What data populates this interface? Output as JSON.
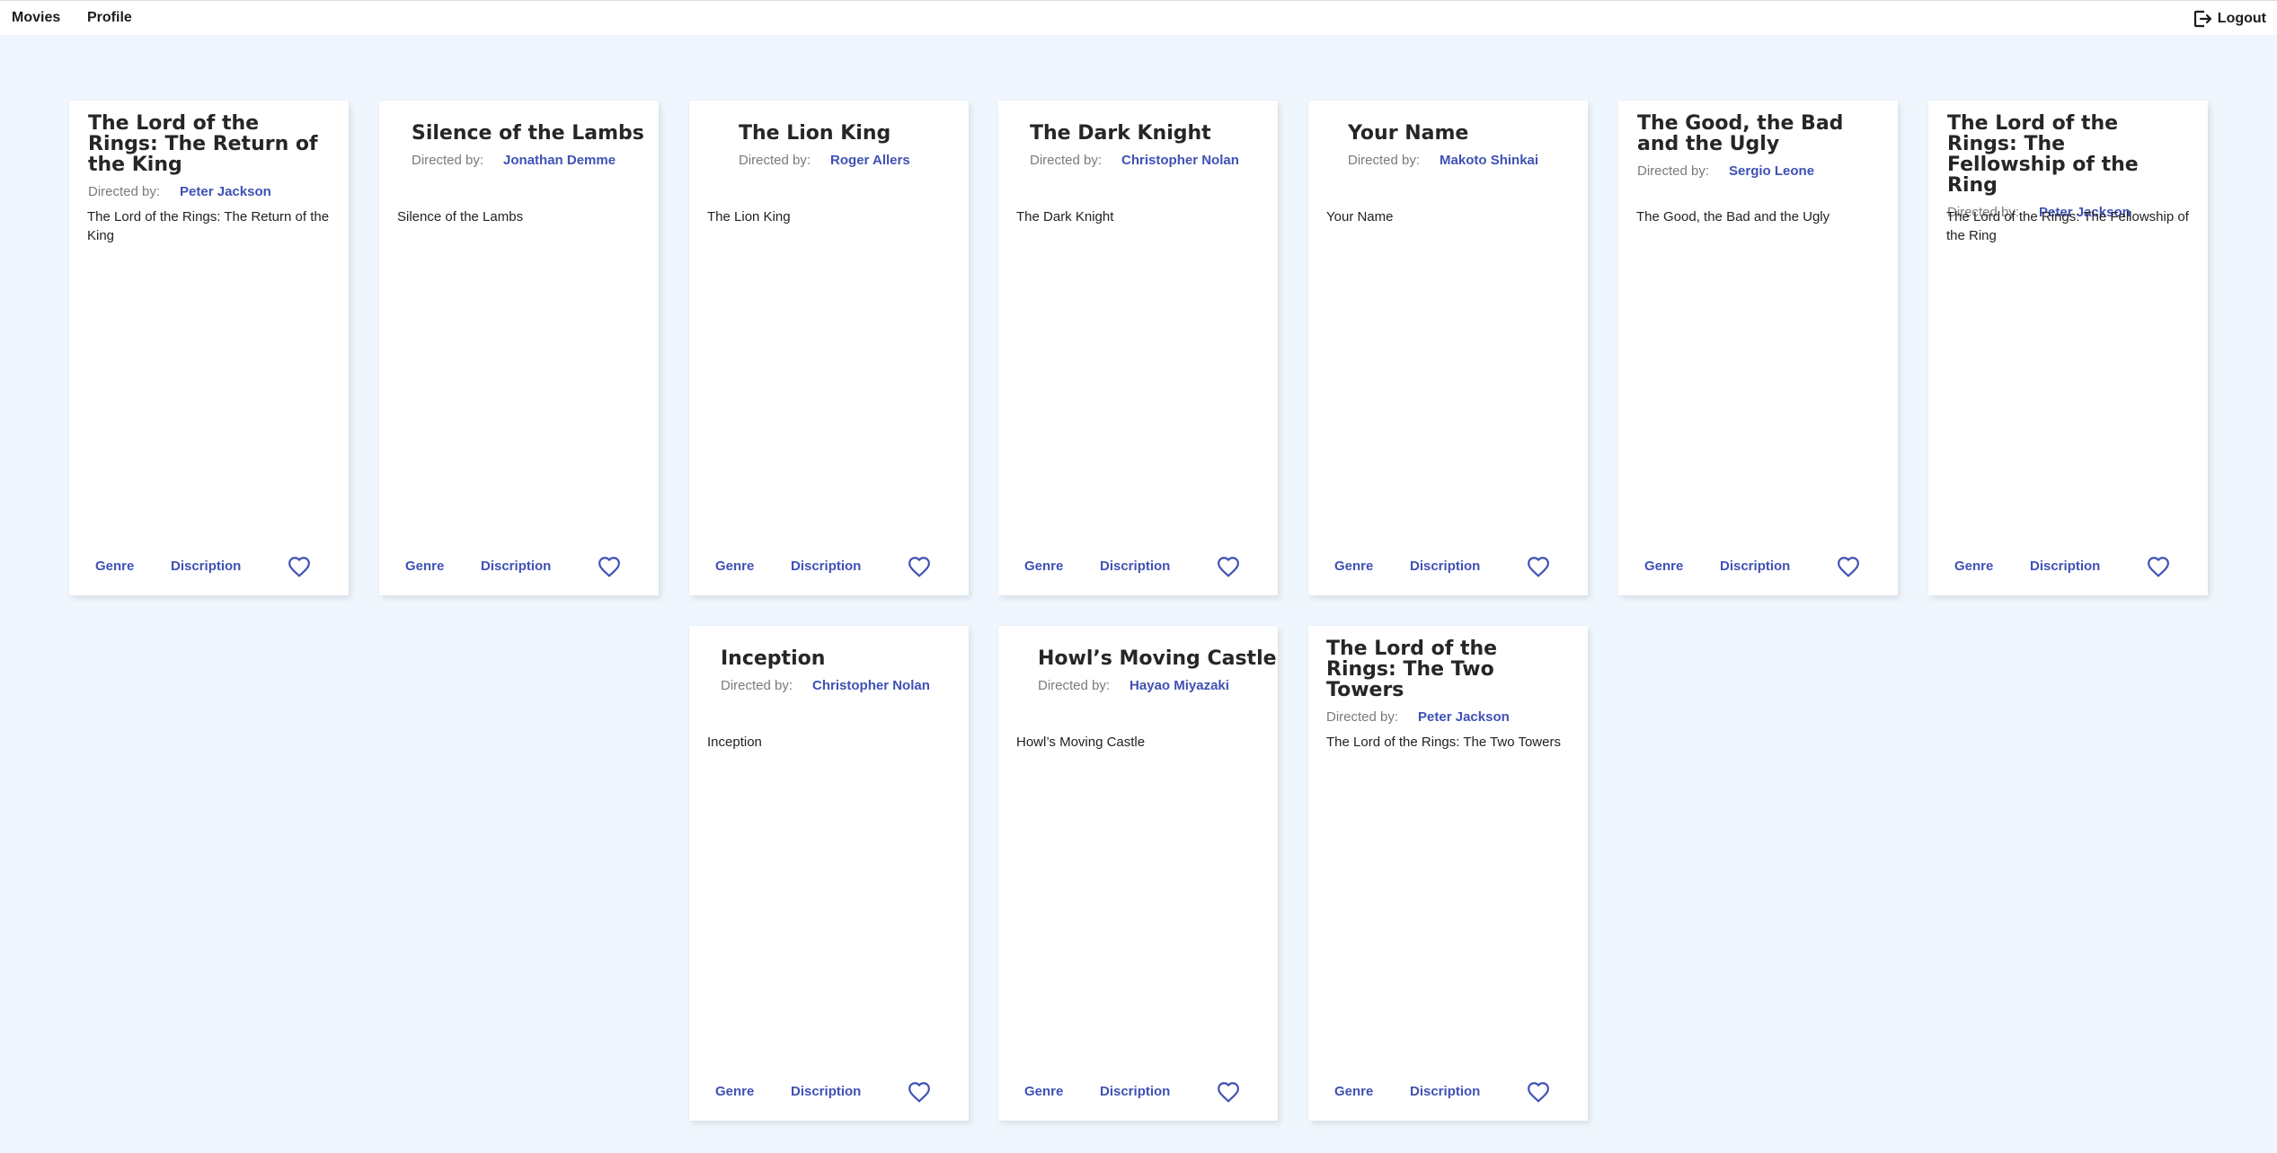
{
  "nav": {
    "movies_label": "Movies",
    "profile_label": "Profile",
    "logout_label": "Logout",
    "logout_icon": "logout-icon"
  },
  "colors": {
    "page_background": "#eff6fd",
    "accent": "#3f51b5",
    "card_background": "#ffffff"
  },
  "card_labels": {
    "directed_by": "Directed by:",
    "genre_button": "Genre",
    "description_button": "Discription",
    "favorite_icon": "heart-outline-icon"
  },
  "movies": [
    {
      "title": "The Lord of the Rings: The Return of the King",
      "director": "Peter Jackson",
      "description": "The Lord of the Rings: The Return of the King"
    },
    {
      "title": "Silence of the Lambs",
      "director": "Jonathan Demme",
      "description": "Silence of the Lambs"
    },
    {
      "title": "The Lion King",
      "director": "Roger Allers",
      "description": "The Lion King"
    },
    {
      "title": "The Dark Knight",
      "director": "Christopher Nolan",
      "description": "The Dark Knight"
    },
    {
      "title": "Your Name",
      "director": "Makoto Shinkai",
      "description": "Your Name"
    },
    {
      "title": "The Good, the Bad and the Ugly",
      "director": "Sergio Leone",
      "description": "The Good, the Bad and the Ugly"
    },
    {
      "title": "The Lord of the Rings: The Fellowship of the Ring",
      "director": "Peter Jackson",
      "description": "The Lord of the Rings: The Fellowship of the Ring"
    },
    {
      "title": "Inception",
      "director": "Christopher Nolan",
      "description": "Inception"
    },
    {
      "title": "Howl’s Moving Castle",
      "director": "Hayao Miyazaki",
      "description": "Howl’s Moving Castle"
    },
    {
      "title": "The Lord of the Rings: The Two Towers",
      "director": "Peter Jackson",
      "description": "The Lord of the Rings: The Two Towers"
    }
  ]
}
